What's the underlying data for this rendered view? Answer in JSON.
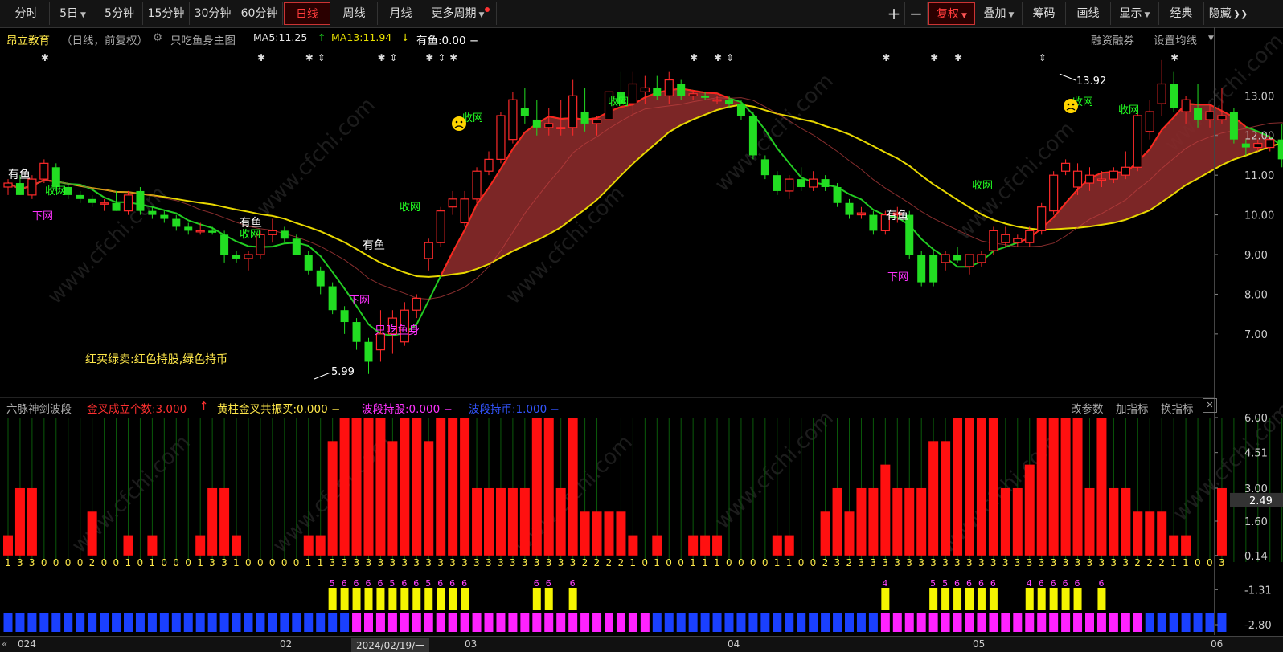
{
  "toolbar": {
    "periods": [
      "分时",
      "5日",
      "5分钟",
      "15分钟",
      "30分钟",
      "60分钟",
      "日线",
      "周线",
      "月线",
      "更多周期"
    ],
    "active_period": "日线",
    "plus": "+",
    "minus": "−",
    "fuquan": "复权",
    "overlay": "叠加",
    "chips": "筹码",
    "draw": "画线",
    "display": "显示",
    "classic": "经典",
    "hide": "隐藏"
  },
  "info": {
    "stock": "昂立教育",
    "period_note": "（日线，前复权）",
    "indicator": "只吃鱼身主图",
    "ma5": "MA5:11.25",
    "ma13": "MA13:11.94",
    "youyu": "有鱼:0.00 −",
    "financing": "融资融券",
    "settings": "设置均线"
  },
  "sub": {
    "name": "六脉神剑波段",
    "golden": "金叉成立个数:3.000",
    "yellow": "黄柱金叉共振买:0.000 −",
    "hold": "波段持股:0.000 −",
    "coin": "波段持币:1.000 −",
    "params": "改参数",
    "add": "加指标",
    "switch": "换指标",
    "close": "✕"
  },
  "main_annotations": {
    "fish": "有鱼",
    "shouwang": "收网",
    "xiawang": "下网",
    "body_label": "只吃鱼身",
    "rule": "红买绿卖:红色持股,绿色持币",
    "high": "13.92",
    "low": "5.99"
  },
  "axis": {
    "main": [
      "13.00",
      "12.00",
      "11.00",
      "10.00",
      "9.00",
      "8.00",
      "7.00"
    ],
    "sub": [
      "6.00",
      "4.51",
      "3.00",
      "1.60",
      "0.14",
      "-1.31",
      "-2.80"
    ],
    "current": "2.49"
  },
  "bottom": {
    "left": "024",
    "dates": [
      "02",
      "03",
      "04",
      "05",
      "06"
    ],
    "cursor_date": "2024/02/19/一"
  },
  "colors": {
    "up": "#ff2a2a",
    "down": "#22dd22",
    "ma_yellow": "#e8d800",
    "band": "#8a2a2a",
    "magenta": "#ff22ff",
    "blue": "#1a40ff",
    "yellow_bar": "#f5f500"
  },
  "chart_data": {
    "type": "candlestick",
    "ylim": [
      5.5,
      14.2
    ],
    "ohlc": [
      [
        10.7,
        10.9,
        10.5,
        10.8
      ],
      [
        10.8,
        11.0,
        10.5,
        10.5
      ],
      [
        10.5,
        11.0,
        10.4,
        10.9
      ],
      [
        10.9,
        11.4,
        10.8,
        11.3
      ],
      [
        11.2,
        11.3,
        10.6,
        10.7
      ],
      [
        10.7,
        10.8,
        10.4,
        10.5
      ],
      [
        10.5,
        10.6,
        10.3,
        10.4
      ],
      [
        10.4,
        10.5,
        10.2,
        10.3
      ],
      [
        10.3,
        10.4,
        10.1,
        10.3
      ],
      [
        10.3,
        10.6,
        10.1,
        10.1
      ],
      [
        10.1,
        10.6,
        10.0,
        10.5
      ],
      [
        10.6,
        10.7,
        10.0,
        10.1
      ],
      [
        10.1,
        10.2,
        9.9,
        10.0
      ],
      [
        10.0,
        10.1,
        9.8,
        9.9
      ],
      [
        9.9,
        10.0,
        9.6,
        9.7
      ],
      [
        9.7,
        9.8,
        9.5,
        9.6
      ],
      [
        9.6,
        9.8,
        9.5,
        9.6
      ],
      [
        9.6,
        9.7,
        9.5,
        9.55
      ],
      [
        9.5,
        9.6,
        8.8,
        9.0
      ],
      [
        9.0,
        9.1,
        8.8,
        8.9
      ],
      [
        8.9,
        9.1,
        8.6,
        9.0
      ],
      [
        9.0,
        9.6,
        8.9,
        9.5
      ],
      [
        9.5,
        9.9,
        9.3,
        9.6
      ],
      [
        9.6,
        9.7,
        9.3,
        9.4
      ],
      [
        9.4,
        9.5,
        9.0,
        9.0
      ],
      [
        9.0,
        9.1,
        8.5,
        8.6
      ],
      [
        8.6,
        8.7,
        8.0,
        8.2
      ],
      [
        8.2,
        8.3,
        7.5,
        7.6
      ],
      [
        7.6,
        7.7,
        7.0,
        7.3
      ],
      [
        7.3,
        7.4,
        6.6,
        6.8
      ],
      [
        6.8,
        6.9,
        5.99,
        6.3
      ],
      [
        6.6,
        7.6,
        6.3,
        7.0
      ],
      [
        7.0,
        7.6,
        6.5,
        7.4
      ],
      [
        6.8,
        7.8,
        6.7,
        7.6
      ],
      [
        7.6,
        8.0,
        7.4,
        7.9
      ],
      [
        8.9,
        9.4,
        8.6,
        9.3
      ],
      [
        9.3,
        10.2,
        9.2,
        10.1
      ],
      [
        10.2,
        10.6,
        10.0,
        10.4
      ],
      [
        9.8,
        10.6,
        9.7,
        10.4
      ],
      [
        10.4,
        11.2,
        10.3,
        11.1
      ],
      [
        11.1,
        11.6,
        11.0,
        11.4
      ],
      [
        11.4,
        12.6,
        11.3,
        12.5
      ],
      [
        11.9,
        13.1,
        11.8,
        12.9
      ],
      [
        12.7,
        13.2,
        12.3,
        12.5
      ],
      [
        12.4,
        12.9,
        12.0,
        12.2
      ],
      [
        12.2,
        12.7,
        12.0,
        12.3
      ],
      [
        12.2,
        12.9,
        12.0,
        12.2
      ],
      [
        12.2,
        13.4,
        12.0,
        13.0
      ],
      [
        12.6,
        13.2,
        12.1,
        12.3
      ],
      [
        12.3,
        12.5,
        12.0,
        12.4
      ],
      [
        12.4,
        13.3,
        12.2,
        13.1
      ],
      [
        13.1,
        13.6,
        12.7,
        12.8
      ],
      [
        12.8,
        13.6,
        12.5,
        13.3
      ],
      [
        13.1,
        13.5,
        12.8,
        13.2
      ],
      [
        13.2,
        13.5,
        12.9,
        13.0
      ],
      [
        13.0,
        13.6,
        12.8,
        13.4
      ],
      [
        13.3,
        13.4,
        12.9,
        13.0
      ],
      [
        13.0,
        13.1,
        12.9,
        13.05
      ],
      [
        13.0,
        13.1,
        12.9,
        12.95
      ],
      [
        12.9,
        13.0,
        12.8,
        12.9
      ],
      [
        12.9,
        13.0,
        12.7,
        12.8
      ],
      [
        12.8,
        12.9,
        12.4,
        12.5
      ],
      [
        12.5,
        12.6,
        11.4,
        11.5
      ],
      [
        11.4,
        11.5,
        10.9,
        11.0
      ],
      [
        11.0,
        11.1,
        10.5,
        10.6
      ],
      [
        10.6,
        11.0,
        10.4,
        10.9
      ],
      [
        10.9,
        11.2,
        10.6,
        10.7
      ],
      [
        10.7,
        11.1,
        10.6,
        10.9
      ],
      [
        10.9,
        11.0,
        10.6,
        10.7
      ],
      [
        10.7,
        10.8,
        10.2,
        10.3
      ],
      [
        10.3,
        10.4,
        9.9,
        10.0
      ],
      [
        10.0,
        10.2,
        9.9,
        10.05
      ],
      [
        10.0,
        10.1,
        9.5,
        9.6
      ],
      [
        9.6,
        10.1,
        9.5,
        10.0
      ],
      [
        10.0,
        10.2,
        9.8,
        10.05
      ],
      [
        10.0,
        10.1,
        8.9,
        9.0
      ],
      [
        9.0,
        9.1,
        8.2,
        8.3
      ],
      [
        9.0,
        9.1,
        8.2,
        8.3
      ],
      [
        8.8,
        9.1,
        8.6,
        9.0
      ],
      [
        9.0,
        9.2,
        8.8,
        8.85
      ],
      [
        8.7,
        9.0,
        8.5,
        9.0
      ],
      [
        8.8,
        9.1,
        8.7,
        9.0
      ],
      [
        9.1,
        9.7,
        9.0,
        9.6
      ],
      [
        9.3,
        9.7,
        9.2,
        9.5
      ],
      [
        9.3,
        9.5,
        9.2,
        9.4
      ],
      [
        9.3,
        9.7,
        9.2,
        9.6
      ],
      [
        9.6,
        10.3,
        9.5,
        10.2
      ],
      [
        10.1,
        11.1,
        10.0,
        11.0
      ],
      [
        11.1,
        11.4,
        11.0,
        11.3
      ],
      [
        10.7,
        11.3,
        10.5,
        11.1
      ],
      [
        10.8,
        11.2,
        10.6,
        11.0
      ],
      [
        10.9,
        11.1,
        10.7,
        10.9
      ],
      [
        10.9,
        11.2,
        10.8,
        11.1
      ],
      [
        11.0,
        11.6,
        10.9,
        11.2
      ],
      [
        11.2,
        12.6,
        11.1,
        12.5
      ],
      [
        12.1,
        12.9,
        11.9,
        12.6
      ],
      [
        12.8,
        13.9,
        12.5,
        13.3
      ],
      [
        13.3,
        13.6,
        12.6,
        12.7
      ],
      [
        12.6,
        13.0,
        12.3,
        12.9
      ],
      [
        12.7,
        13.3,
        12.2,
        12.4
      ],
      [
        12.4,
        12.8,
        12.2,
        12.6
      ],
      [
        12.4,
        13.2,
        12.3,
        12.5
      ],
      [
        12.6,
        12.7,
        11.8,
        11.9
      ],
      [
        11.8,
        11.9,
        11.5,
        11.7
      ],
      [
        11.7,
        11.9,
        11.6,
        11.8
      ],
      [
        11.7,
        12.0,
        11.6,
        11.9
      ],
      [
        11.9,
        12.3,
        11.2,
        11.4
      ],
      [
        11.4,
        11.5,
        11.1,
        11.2
      ],
      [
        11.2,
        11.3,
        10.9,
        11.0
      ],
      [
        11.0,
        11.1,
        10.8,
        10.9
      ],
      [
        10.9,
        11.0,
        10.8,
        10.85
      ],
      [
        10.9,
        12.0,
        10.5,
        11.9
      ]
    ],
    "signals": [
      1,
      3,
      3,
      0,
      0,
      0,
      0,
      2,
      0,
      0,
      1,
      0,
      1,
      0,
      0,
      0,
      1,
      3,
      3,
      1,
      0,
      0,
      0,
      0,
      0,
      1,
      1,
      5,
      6,
      6,
      6,
      6,
      5,
      6,
      6,
      5,
      6,
      6,
      6,
      3,
      3,
      3,
      3,
      3,
      6,
      6,
      3,
      6,
      2,
      2,
      2,
      2,
      1,
      0,
      1,
      0,
      0,
      1,
      1,
      1,
      0,
      0,
      0,
      0,
      1,
      1,
      0,
      0,
      2,
      3,
      2,
      3,
      3,
      4,
      3,
      3,
      3,
      5,
      5,
      6,
      6,
      6,
      6,
      3,
      3,
      4,
      6,
      6,
      6,
      6,
      3,
      6,
      3,
      3,
      2,
      2,
      2,
      1,
      1,
      0,
      0,
      3
    ],
    "signal_range": [
      -2.8,
      6.0
    ]
  }
}
